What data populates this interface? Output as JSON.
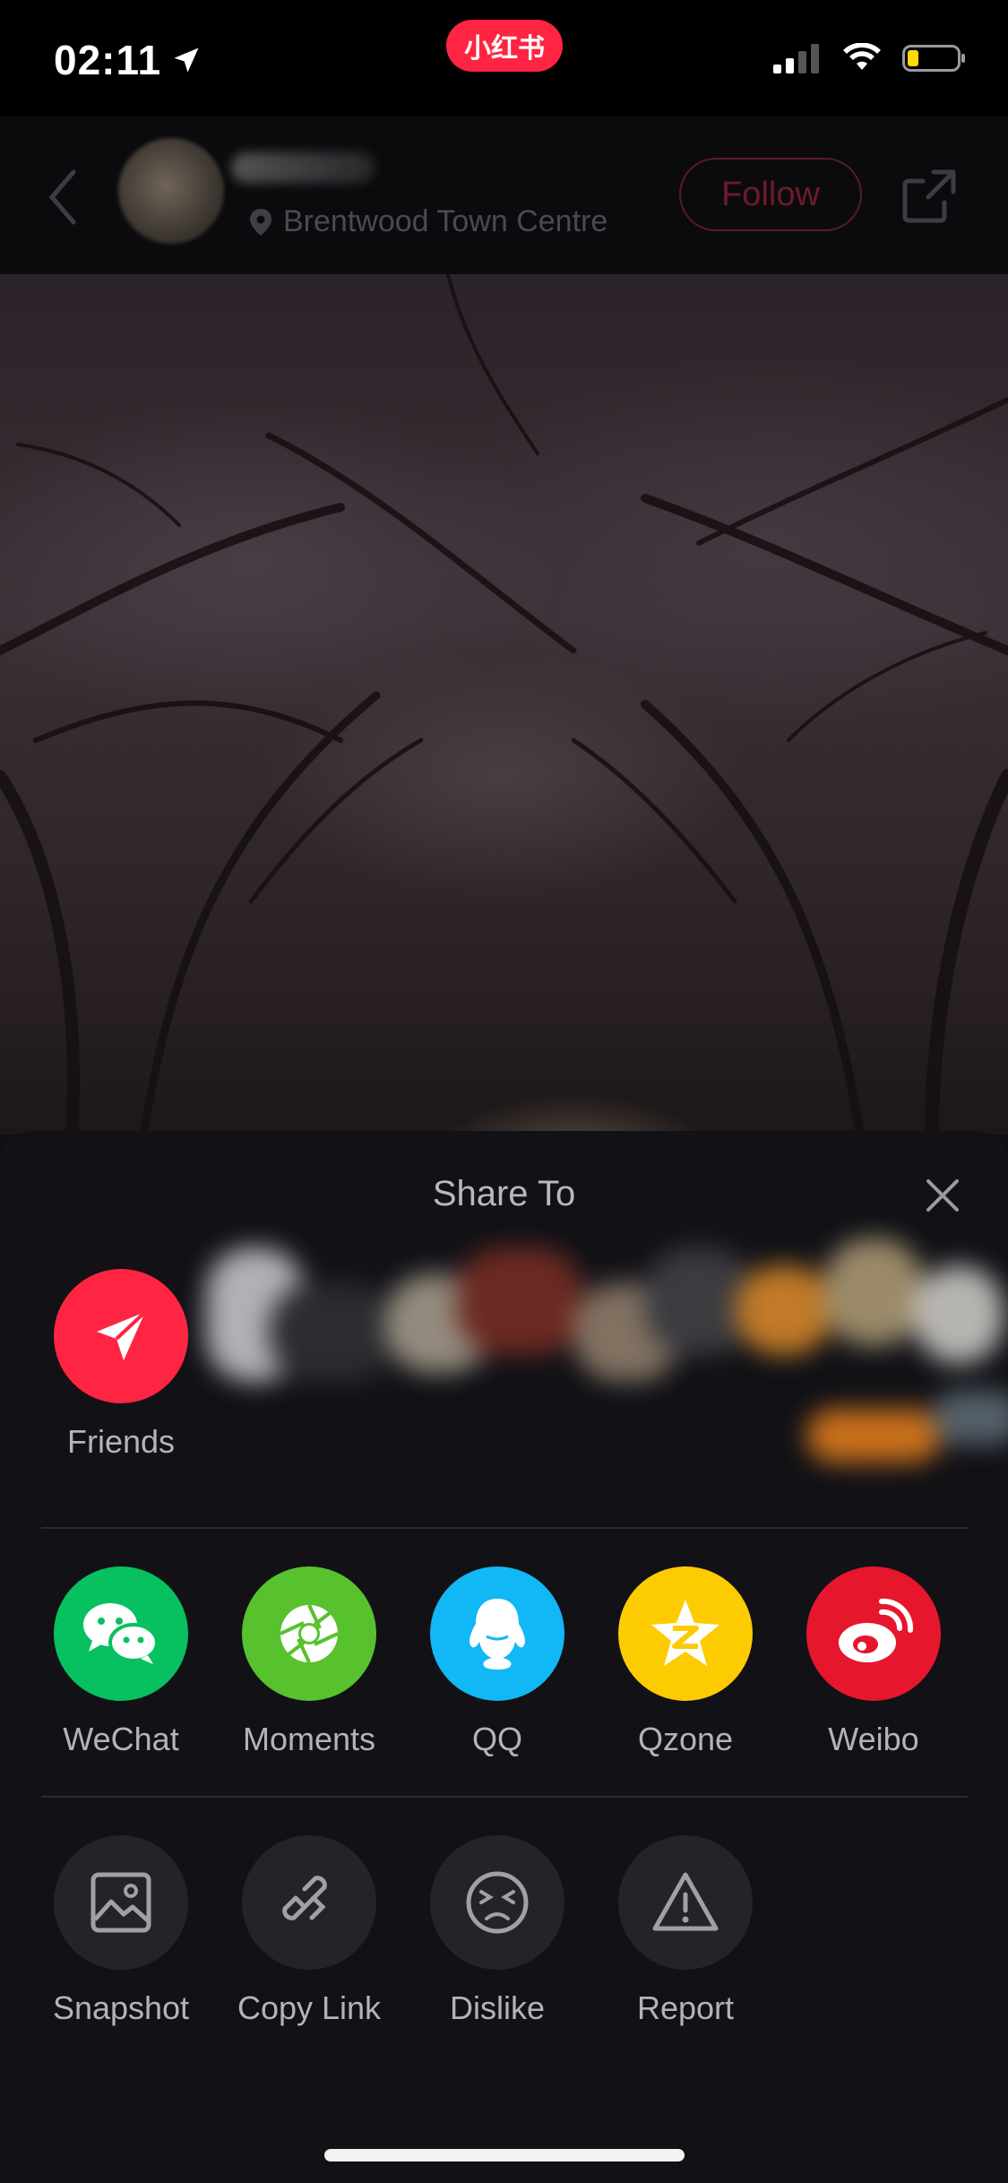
{
  "status_bar": {
    "time": "02:11",
    "app_badge": "小红书",
    "badge_color": "#ff2442"
  },
  "header": {
    "location": "Brentwood Town Centre",
    "follow_label": "Follow"
  },
  "share_sheet": {
    "title": "Share To",
    "friends_label": "Friends",
    "apps": [
      {
        "label": "WeChat",
        "color": "#07c160",
        "icon": "wechat-icon"
      },
      {
        "label": "Moments",
        "color": "#57c22d",
        "icon": "moments-icon"
      },
      {
        "label": "QQ",
        "color": "#12b7f5",
        "icon": "qq-icon"
      },
      {
        "label": "Qzone",
        "color": "#fdcc00",
        "icon": "qzone-icon"
      },
      {
        "label": "Weibo",
        "color": "#e6162d",
        "icon": "weibo-icon"
      }
    ],
    "actions": [
      {
        "label": "Snapshot",
        "icon": "snapshot-icon"
      },
      {
        "label": "Copy Link",
        "icon": "link-icon"
      },
      {
        "label": "Dislike",
        "icon": "dislike-icon"
      },
      {
        "label": "Report",
        "icon": "report-icon"
      }
    ]
  }
}
